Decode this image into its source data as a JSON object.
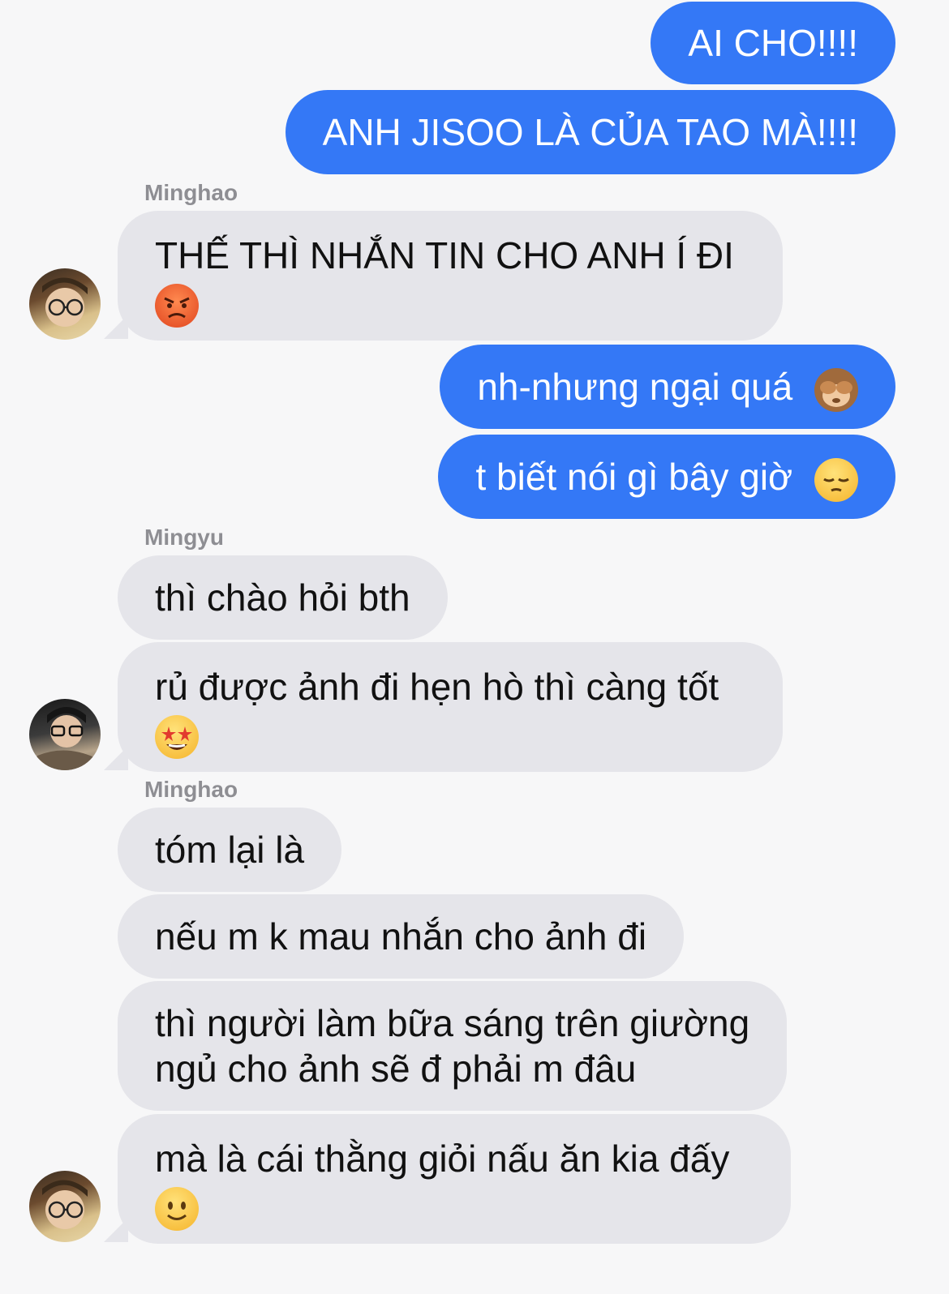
{
  "messages": [
    {
      "id": "m1",
      "text": "AI CHO!!!!"
    },
    {
      "id": "m2",
      "text": "ANH JISOO LÀ CỦA TAO MÀ!!!!"
    },
    {
      "id": "m3",
      "sender": "Minghao",
      "text": "THẾ THÌ NHẮN TIN CHO ANH Í ĐI",
      "emoji": "angry-face-emoji"
    },
    {
      "id": "m4",
      "text": "nh-nhưng ngại quá",
      "emoji": "see-no-evil-monkey-emoji"
    },
    {
      "id": "m5",
      "text": "t biết nói gì bây giờ",
      "emoji": "pensive-face-emoji"
    },
    {
      "id": "m6",
      "sender": "Mingyu",
      "text": "thì chào hỏi bth"
    },
    {
      "id": "m7",
      "text": "rủ được ảnh đi hẹn hò thì càng tốt",
      "emoji": "star-struck-emoji"
    },
    {
      "id": "m8",
      "sender": "Minghao",
      "text": "tóm lại là"
    },
    {
      "id": "m9",
      "text": "nếu m k mau nhắn cho ảnh đi"
    },
    {
      "id": "m10",
      "line1": "thì người làm bữa sáng trên giường",
      "line2": "ngủ cho ảnh sẽ đ phải m đâu"
    },
    {
      "id": "m11",
      "text": "mà là cái thằng giỏi nấu ăn kia đấy",
      "emoji": "slightly-smiling-face-emoji"
    }
  ],
  "colors": {
    "outgoing_bubble": "#3478f6",
    "incoming_bubble": "#e5e5ea",
    "background": "#f7f7f8",
    "sender_name": "#8e8e93"
  }
}
